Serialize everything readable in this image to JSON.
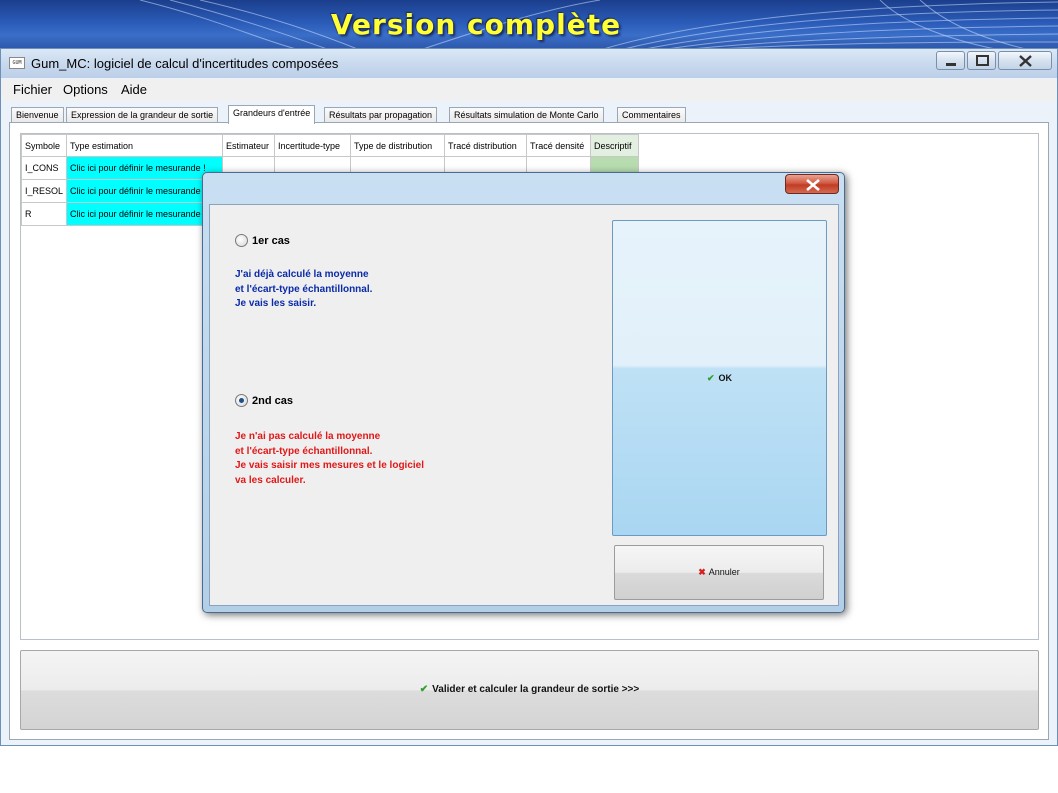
{
  "banner": {
    "title": "Version complète"
  },
  "window": {
    "icon_text": "GUM",
    "title": "Gum_MC: logiciel de calcul d'incertitudes composées"
  },
  "menu": [
    "Fichier",
    "Options",
    "Aide"
  ],
  "tabs": [
    {
      "label": "Bienvenue"
    },
    {
      "label": "Expression de la grandeur de sortie"
    },
    {
      "label": "Grandeurs d'entrée",
      "active": true
    },
    {
      "label": "Résultats par propagation"
    },
    {
      "label": "Résultats simulation de Monte Carlo"
    },
    {
      "label": "Commentaires"
    }
  ],
  "table": {
    "headers": [
      "Symbole",
      "Type estimation",
      "Estimateur",
      "Incertitude-type",
      "Type de distribution",
      "Tracé distribution",
      "Tracé densité",
      "Descriptif"
    ],
    "rows": [
      {
        "symbole": "I_CONS",
        "type_estimation": "Clic ici pour définir le mesurande !"
      },
      {
        "symbole": "I_RESOL",
        "type_estimation": "Clic ici pour définir le mesurande !"
      },
      {
        "symbole": "R",
        "type_estimation": "Clic ici pour définir le mesurande !"
      }
    ]
  },
  "validate_button": {
    "label": "Valider et calculer la grandeur de sortie >>>"
  },
  "dialog": {
    "option1": {
      "label": "1er cas",
      "checked": false,
      "lines": [
        "J'ai déjà calculé la moyenne",
        "et l'écart-type échantillonnal.",
        "Je vais les saisir."
      ]
    },
    "option2": {
      "label": "2nd cas",
      "checked": true,
      "lines": [
        "Je n'ai pas calculé la moyenne",
        "et l'écart-type échantillonnal.",
        "Je vais  saisir mes mesures et le logiciel",
        "va les calculer."
      ]
    },
    "ok_label": "OK",
    "cancel_label": "Annuler"
  },
  "colors": {
    "estimation_cell": "#00ffff",
    "descriptif_cell": "#b6dcaf",
    "banner_text": "#ffff33",
    "option1_text": "#0a2aa8",
    "option2_text": "#e01818"
  }
}
